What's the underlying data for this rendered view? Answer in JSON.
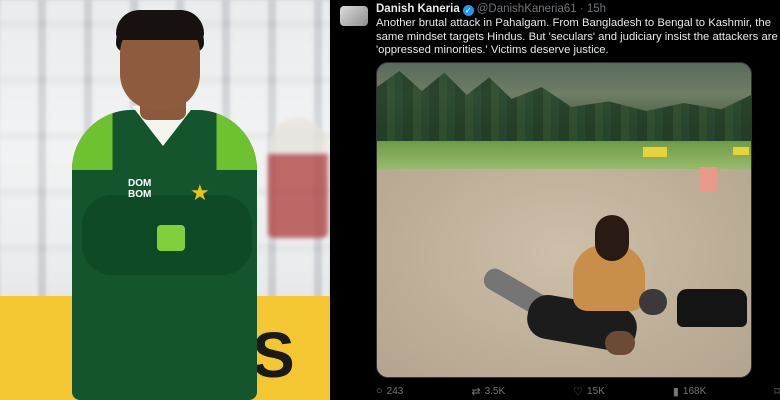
{
  "tweet": {
    "author_name": "Danish Kaneria",
    "handle": "@DanishKaneria61",
    "separator": "·",
    "time": "15h",
    "text": "Another brutal attack in Pahalgam. From Bangladesh to Bengal to Kashmir, the same mindset targets Hindus. But 'seculars' and judiciary insist the attackers are 'oppressed minorities.' Victims deserve justice.",
    "verified_icon": "verified-badge-icon",
    "actions": {
      "replies": "243",
      "retweets": "3.5K",
      "likes": "15K",
      "views": "168K"
    }
  },
  "photo": {
    "jersey_sponsor_line1": "DOM",
    "jersey_sponsor_line2": "BOM",
    "ad_board_text": "S"
  },
  "colors": {
    "jersey_green": "#14552e",
    "accent_lime": "#6ec22f",
    "verified_blue": "#1d9bf0",
    "tweet_bg": "#000000"
  }
}
